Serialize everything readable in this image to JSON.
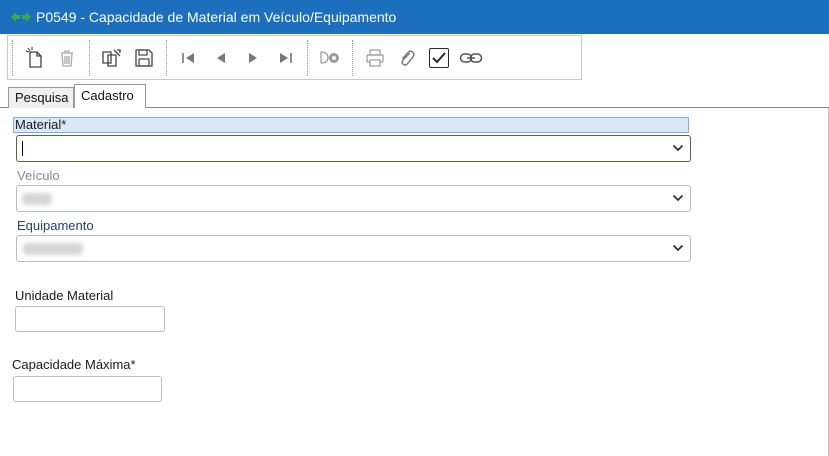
{
  "window": {
    "title": "P0549 - Capacidade de Material em Veículo/Equipamento"
  },
  "toolbar": {
    "buttons": [
      {
        "name": "new-document-icon"
      },
      {
        "name": "delete-icon"
      },
      {
        "name": "copy-icon"
      },
      {
        "name": "save-icon"
      },
      {
        "name": "first-record-icon"
      },
      {
        "name": "previous-record-icon"
      },
      {
        "name": "next-record-icon"
      },
      {
        "name": "last-record-icon"
      },
      {
        "name": "search-record-icon"
      },
      {
        "name": "print-icon"
      },
      {
        "name": "attachment-icon"
      },
      {
        "name": "confirm-check-icon"
      },
      {
        "name": "link-icon"
      }
    ]
  },
  "tabs": [
    {
      "label": "Pesquisa",
      "active": false
    },
    {
      "label": "Cadastro",
      "active": true
    }
  ],
  "form": {
    "material": {
      "label": "Material*",
      "value": ""
    },
    "veiculo": {
      "label": "Veículo"
    },
    "equipamento": {
      "label": "Equipamento"
    },
    "unidade_material": {
      "label": "Unidade Material",
      "value": ""
    },
    "capacidade_maxima": {
      "label": "Capacidade Máxima*",
      "value": ""
    }
  },
  "colors": {
    "titlebar": "#1b6fbd",
    "focus_border": "#4a6f3a",
    "label_focus_bg": "#dbe9f7"
  }
}
